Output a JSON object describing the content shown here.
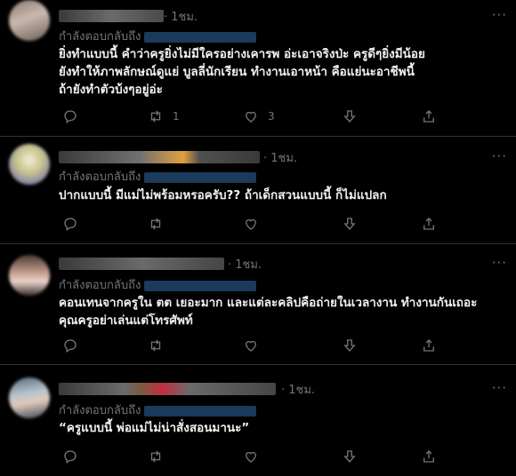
{
  "tweets": [
    {
      "time": "· 1ชม.",
      "replying": "กำลังตอบกลับถึง",
      "text": "ยิ่งทำแบบนี้ คำว่าครูยิ่งไม่มีใครอย่างเคารพ อ่ะเอาจริงป่ะ ครูดีๆยิ่งมีน้อย\nยังทำให้ภาพลักษณ์ดูแย่ บูลลี่นักเรียน ทำงานเอาหน้า คือแย่นะอาชีพนี้\nถ้ายังทำตัวบ้งๆอยู่อ่ะ",
      "retweets": "1",
      "likes": "3"
    },
    {
      "time": "· 1ชม.",
      "replying": "กำลังตอบกลับถึง",
      "text": "ปากแบบนี้ มีแม่ไม่พร้อมหรอครับ?? ถ้าเด็กสวนแบบนี้ ก็ไม่แปลก",
      "retweets": "",
      "likes": ""
    },
    {
      "time": "· 1ชม.",
      "replying": "กำลังตอบกลับถึง",
      "text": "คอนเทนจากครูใน ตต เยอะมาก และแต่ละคลิปคือถ่ายในเวลางาน ทำงานกันเถอะ\nคุณครูอย่าเล่นแต่โทรศัพท์",
      "retweets": "",
      "likes": ""
    },
    {
      "time": "· 1ชม.",
      "replying": "กำลังตอบกลับถึง",
      "text": "“ครูแบบนี้ พ่อแม่ไม่น่าสั่งสอนมานะ”",
      "retweets": "",
      "likes": ""
    }
  ],
  "icons": [
    "reply-icon",
    "retweet-icon",
    "like-icon",
    "downvote-icon",
    "share-icon",
    "more-icon"
  ],
  "colors": {
    "background": "#000000",
    "muted": "#71767b",
    "divider": "#2f3336"
  }
}
